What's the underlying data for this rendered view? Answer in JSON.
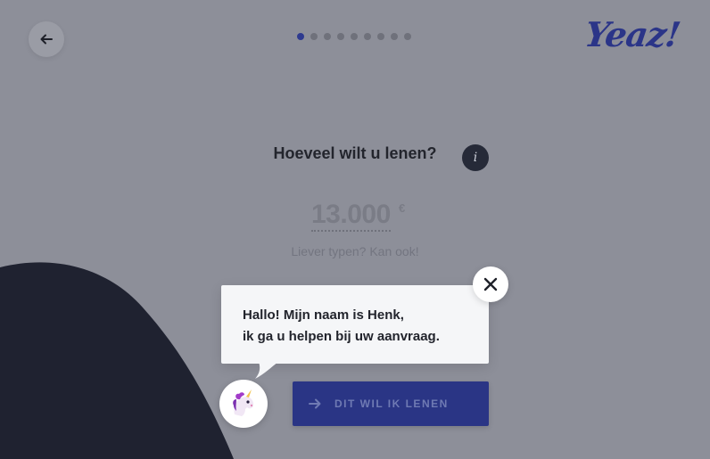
{
  "header": {
    "logo_text": "Yeaz!",
    "progress": {
      "total_steps": 9,
      "current_step": 1
    }
  },
  "question": {
    "title": "Hoeveel wilt u lenen?",
    "info_glyph": "i"
  },
  "amount": {
    "value": "13.000",
    "currency": "€",
    "hint": "Liever typen? Kan ook!"
  },
  "cta": {
    "label": "DIT WIL IK LENEN"
  },
  "chat": {
    "line1": "Hallo! Mijn naam is Henk,",
    "line2": "ik ga u helpen bij uw aanvraag.",
    "avatar_icon": "unicorn-icon"
  },
  "colors": {
    "overlay_bg": "#8d8f99",
    "brand_blue": "#2a3585",
    "dark_shape": "#1f2230",
    "bubble_bg": "#f5f6f8"
  }
}
